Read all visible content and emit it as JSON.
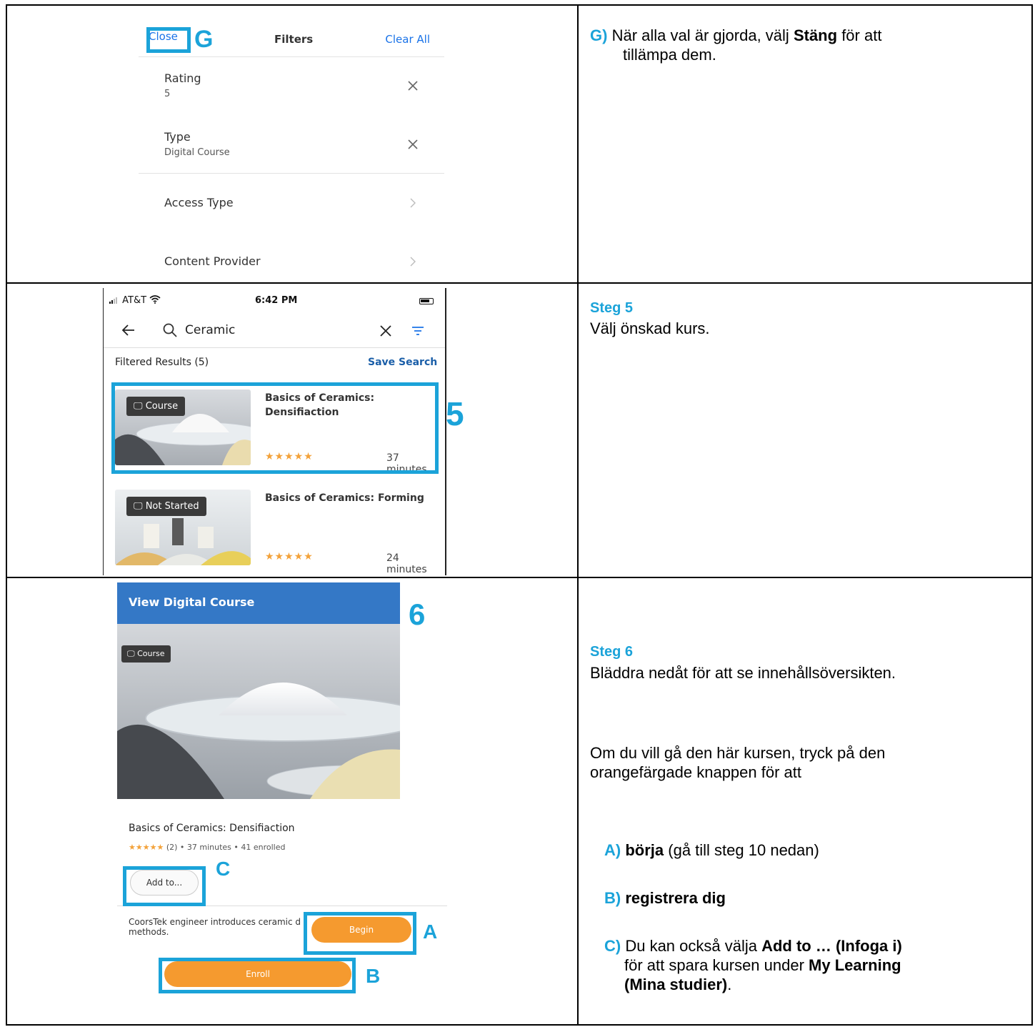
{
  "row1": {
    "filters": {
      "close": "Close",
      "title": "Filters",
      "clear_all": "Clear All",
      "rating_label": "Rating",
      "rating_value": "5",
      "type_label": "Type",
      "type_value": "Digital Course",
      "access_type": "Access Type",
      "content_provider": "Content Provider"
    },
    "callout": "G",
    "instruction": {
      "letter": "G)",
      "text_1": "När alla val är gjorda, välj",
      "bold": "Stäng",
      "text_2": "för att",
      "text_3": "tillämpa dem."
    }
  },
  "row2": {
    "status": {
      "carrier": "AT&T",
      "time": "6:42 PM"
    },
    "search": {
      "query": "Ceramic"
    },
    "results_heading": "Filtered Results (5)",
    "save_search": "Save Search",
    "results": [
      {
        "badge": "Course",
        "title": "Basics of Ceramics: Densifiaction",
        "stars": "★★★★★",
        "duration": "37 minutes"
      },
      {
        "badge": "Not Started",
        "title": "Basics of Ceramics: Forming",
        "stars": "★★★★★",
        "duration": "24 minutes"
      }
    ],
    "callout": "5",
    "step_title": "Steg 5",
    "step_text": "Välj önskad kurs."
  },
  "row3": {
    "header": "View Digital Course",
    "badge": "Course",
    "course_name": "Basics of Ceramics: Densifiaction",
    "stars": "★★★★★",
    "meta": "(2)  •  37 minutes  •  41 enrolled",
    "add_to": "Add to...",
    "description": "CoorsTek engineer introduces ceramic d methods.",
    "begin": "Begin",
    "enroll": "Enroll",
    "callout_6": "6",
    "callout_a": "A",
    "callout_b": "B",
    "callout_c": "C",
    "step_title": "Steg 6",
    "step_text": "Bläddra nedåt för att se innehållsöversikten.",
    "para_line1": "Om du vill gå den här kursen, tryck på den",
    "para_line2": "orangefärgade knappen för att",
    "item_a": {
      "letter": "A)",
      "bold": "börja",
      "rest": " (gå till steg 10 nedan)"
    },
    "item_b": {
      "letter": "B)",
      "bold": "registrera dig"
    },
    "item_c": {
      "letter": "C)",
      "text_1": " Du kan också välja ",
      "bold_1": "Add to … (Infoga i)",
      "text_2": "för att spara kursen under ",
      "bold_2": "My Learning",
      "bold_3": "(Mina studier)",
      "text_3": "."
    }
  },
  "colors": {
    "accent": "#1ba3d9",
    "link": "#1a73e8",
    "orange": "#f59a2f",
    "header_blue": "#3478c6",
    "star": "#f3a23a"
  }
}
